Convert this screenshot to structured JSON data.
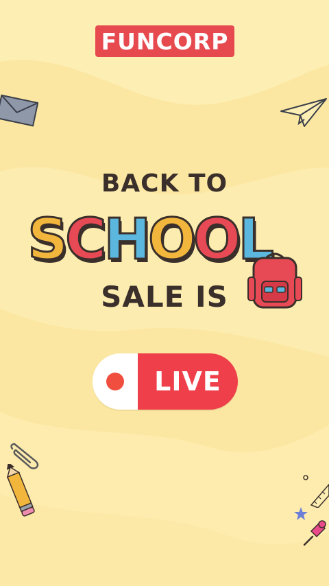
{
  "brand": {
    "logo_text": "FUNCORP",
    "logo_color": "#e64a4f"
  },
  "headline": {
    "line1": "BACK TO",
    "word": "SCHOOL",
    "line3": "SALE IS"
  },
  "school_letter_colors": [
    "#f2b63c",
    "#e84a55",
    "#5bb7dd",
    "#f2b63c",
    "#e84a55",
    "#5bb7dd"
  ],
  "live_badge": {
    "label": "LIVE",
    "dot_color": "#f04e3e",
    "pill_color": "#ee3f4a"
  },
  "background_colors": {
    "base": "#fbe7a1",
    "wave": "#fdeeb3"
  },
  "icons": [
    "envelope-icon",
    "paper-plane-icon",
    "paperclip-icon",
    "pencil-icon",
    "backpack-icon",
    "pushpin-icon",
    "star-icon"
  ]
}
